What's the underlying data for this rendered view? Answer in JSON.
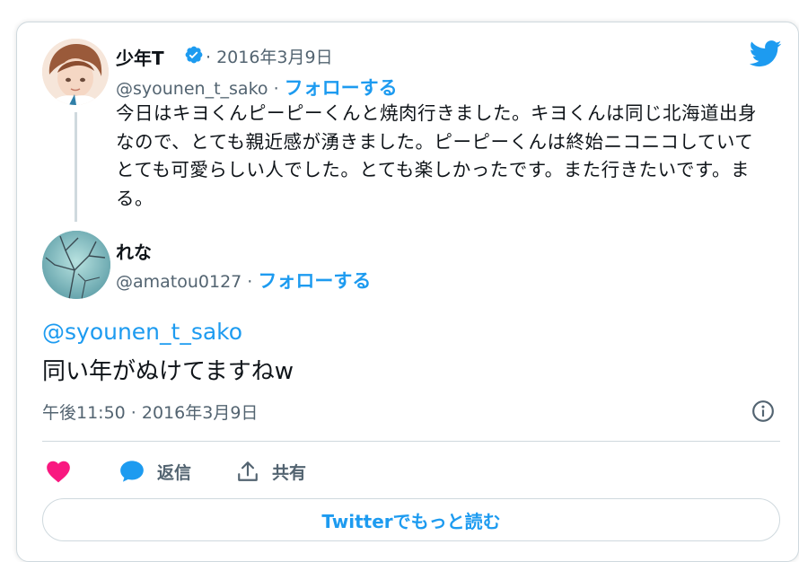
{
  "quoted_tweet": {
    "author_name": "少年T",
    "date": "· 2016年3月9日",
    "handle": "@syounen_t_sako ·",
    "follow_label": "フォローする",
    "text": "今日はキヨくんピーピーくんと焼肉行きました。キヨくんは同じ北海道出身なので、とても親近感が湧きました。ピーピーくんは終始ニコニコしていてとても可愛らしい人でした。とても楽しかったです。また行きたいです。まる。"
  },
  "reply_tweet": {
    "author_name": "れな",
    "handle": "@amatou0127 ·",
    "follow_label": "フォローする",
    "mention": "@syounen_t_sako",
    "text": "同い年がぬけてますねw",
    "timestamp": "午後11:50 · 2016年3月9日"
  },
  "actions": {
    "reply_label": "返信",
    "share_label": "共有"
  },
  "read_more_label": "Twitterでもっと読む",
  "icons": [
    "twitter-bird-icon",
    "verified-badge-icon",
    "info-icon",
    "heart-icon",
    "reply-bubble-icon",
    "share-icon"
  ],
  "colors": {
    "accent": "#1d9bf0",
    "like": "#f91880",
    "text": "#0f1419",
    "secondary": "#536471",
    "border": "#cfd9de"
  }
}
